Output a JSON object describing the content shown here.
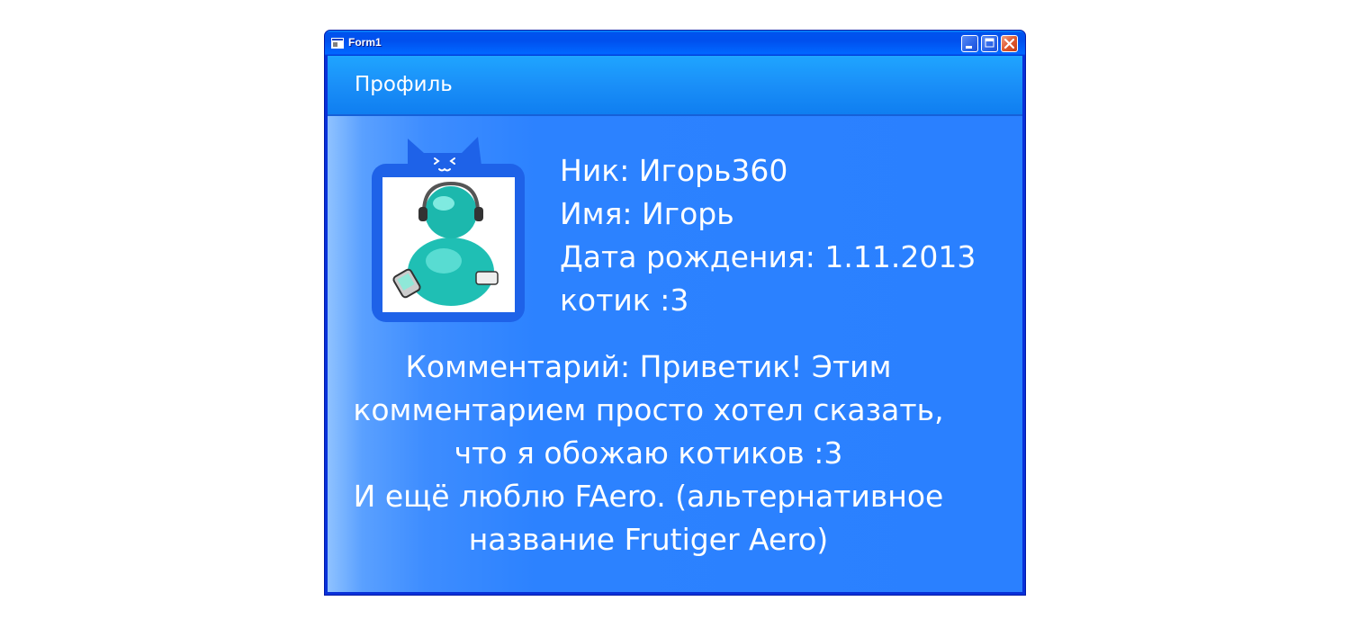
{
  "window": {
    "title": "Form1",
    "buttons": {
      "minimize": "minimize",
      "maximize": "maximize",
      "close": "close"
    }
  },
  "header": {
    "title": "Профиль"
  },
  "profile": {
    "avatar_icon": "msn-person-headphones-icon",
    "nick": "Ник: Игорь360",
    "name": "Имя: Игорь",
    "birth_date": "Дата рождения: 1.11.2013",
    "note": "котик :3"
  },
  "comment": {
    "lines": [
      "Комментарий: Приветик! Этим",
      "комментарием просто хотел сказать,",
      "что я обожаю котиков :3",
      "И ещё люблю FAero. (альтернативное",
      "название Frutiger Aero)"
    ]
  },
  "colors": {
    "titlebar": "#0053ee",
    "client": "#2a80ff",
    "header_band": "#1a8ff8",
    "text": "#ffffff"
  }
}
